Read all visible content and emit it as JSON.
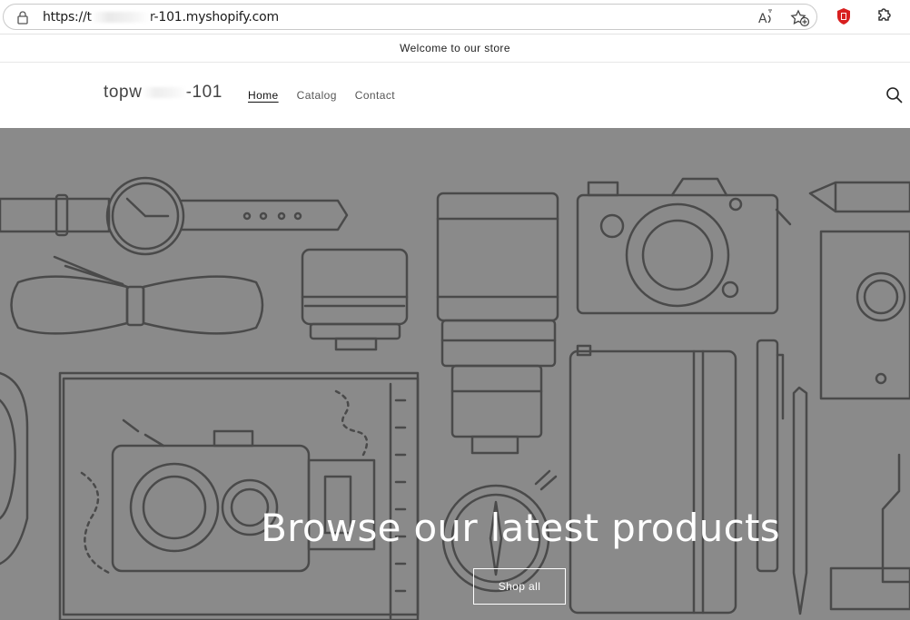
{
  "browser": {
    "url_prefix": "https://t",
    "url_suffix": "r-101.myshopify.com",
    "icons": [
      "lock-icon",
      "read-aloud-icon",
      "favorites-icon",
      "adblock-extension-icon",
      "extensions-icon"
    ]
  },
  "announcement": {
    "text": "Welcome to our store"
  },
  "header": {
    "logo_prefix": "topw",
    "logo_suffix": "-101",
    "nav": [
      {
        "label": "Home",
        "active": true
      },
      {
        "label": "Catalog",
        "active": false
      },
      {
        "label": "Contact",
        "active": false
      }
    ]
  },
  "hero": {
    "title": "Browse our latest products",
    "button_label": "Shop all",
    "background_color": "#8a8a8a"
  }
}
